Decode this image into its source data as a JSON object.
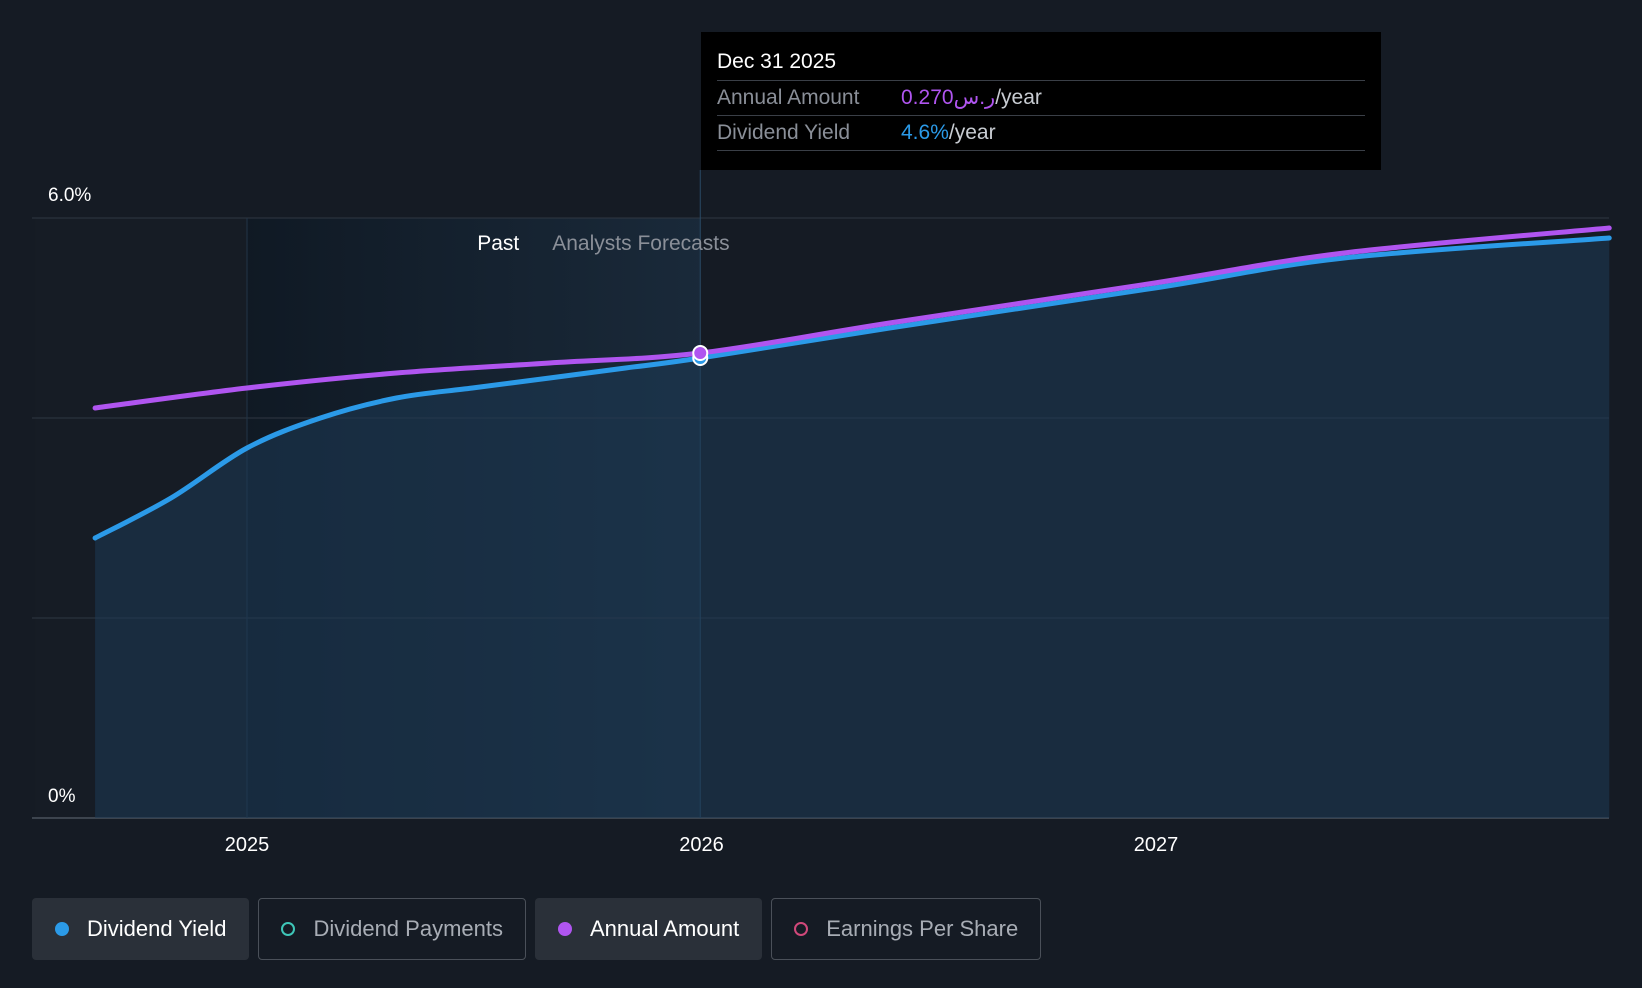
{
  "chart_data": {
    "type": "line",
    "y_axis": {
      "labels": [
        "6.0%",
        "0%"
      ],
      "ylim": [
        0,
        6.0
      ],
      "unit": "%"
    },
    "x_axis": {
      "tick_labels": [
        "2025",
        "2026",
        "2027"
      ]
    },
    "regions": {
      "past_label": "Past",
      "forecast_label": "Analysts Forecasts"
    },
    "series": [
      {
        "name": "Dividend Yield",
        "color": "#2b9ae8",
        "points": [
          [
            "2024-09-01",
            2.8
          ],
          [
            "2024-11-01",
            3.2
          ],
          [
            "2025-01-01",
            3.7
          ],
          [
            "2025-03-01",
            4.0
          ],
          [
            "2025-05-01",
            4.2
          ],
          [
            "2025-07-01",
            4.3
          ],
          [
            "2025-09-01",
            4.4
          ],
          [
            "2025-11-01",
            4.5
          ],
          [
            "2025-12-31",
            4.6
          ],
          [
            "2026-06-01",
            4.9
          ],
          [
            "2026-12-31",
            5.3
          ],
          [
            "2027-06-01",
            5.6
          ],
          [
            "2027-12-31",
            5.8
          ]
        ]
      },
      {
        "name": "Annual Amount",
        "color": "#b055f0",
        "points": [
          [
            "2024-09-01",
            4.1
          ],
          [
            "2025-01-01",
            4.3
          ],
          [
            "2025-05-01",
            4.45
          ],
          [
            "2025-09-01",
            4.55
          ],
          [
            "2025-12-31",
            4.65
          ],
          [
            "2026-06-01",
            4.95
          ],
          [
            "2026-12-31",
            5.35
          ],
          [
            "2027-06-01",
            5.65
          ],
          [
            "2027-12-31",
            5.9
          ]
        ]
      }
    ],
    "highlight": {
      "date": "Dec 31 2025",
      "annual_amount": "0.270",
      "annual_currency": "ر.س",
      "annual_unit": "/year",
      "dividend_yield": "4.6%",
      "yield_unit": "/year"
    }
  },
  "tooltip": {
    "date": "Dec 31 2025",
    "annual_label": "Annual Amount",
    "annual_value": "0.270ر.س",
    "annual_unit": "/year",
    "yield_label": "Dividend Yield",
    "yield_value": "4.6%",
    "yield_unit": "/year"
  },
  "legend": [
    {
      "label": "Dividend Yield",
      "color": "#2b9ae8",
      "active": true,
      "filled": true
    },
    {
      "label": "Dividend Payments",
      "color": "#3ec6b8",
      "active": false,
      "filled": false
    },
    {
      "label": "Annual Amount",
      "color": "#b055f0",
      "active": true,
      "filled": true
    },
    {
      "label": "Earnings Per Share",
      "color": "#d0487a",
      "active": false,
      "filled": false
    }
  ]
}
